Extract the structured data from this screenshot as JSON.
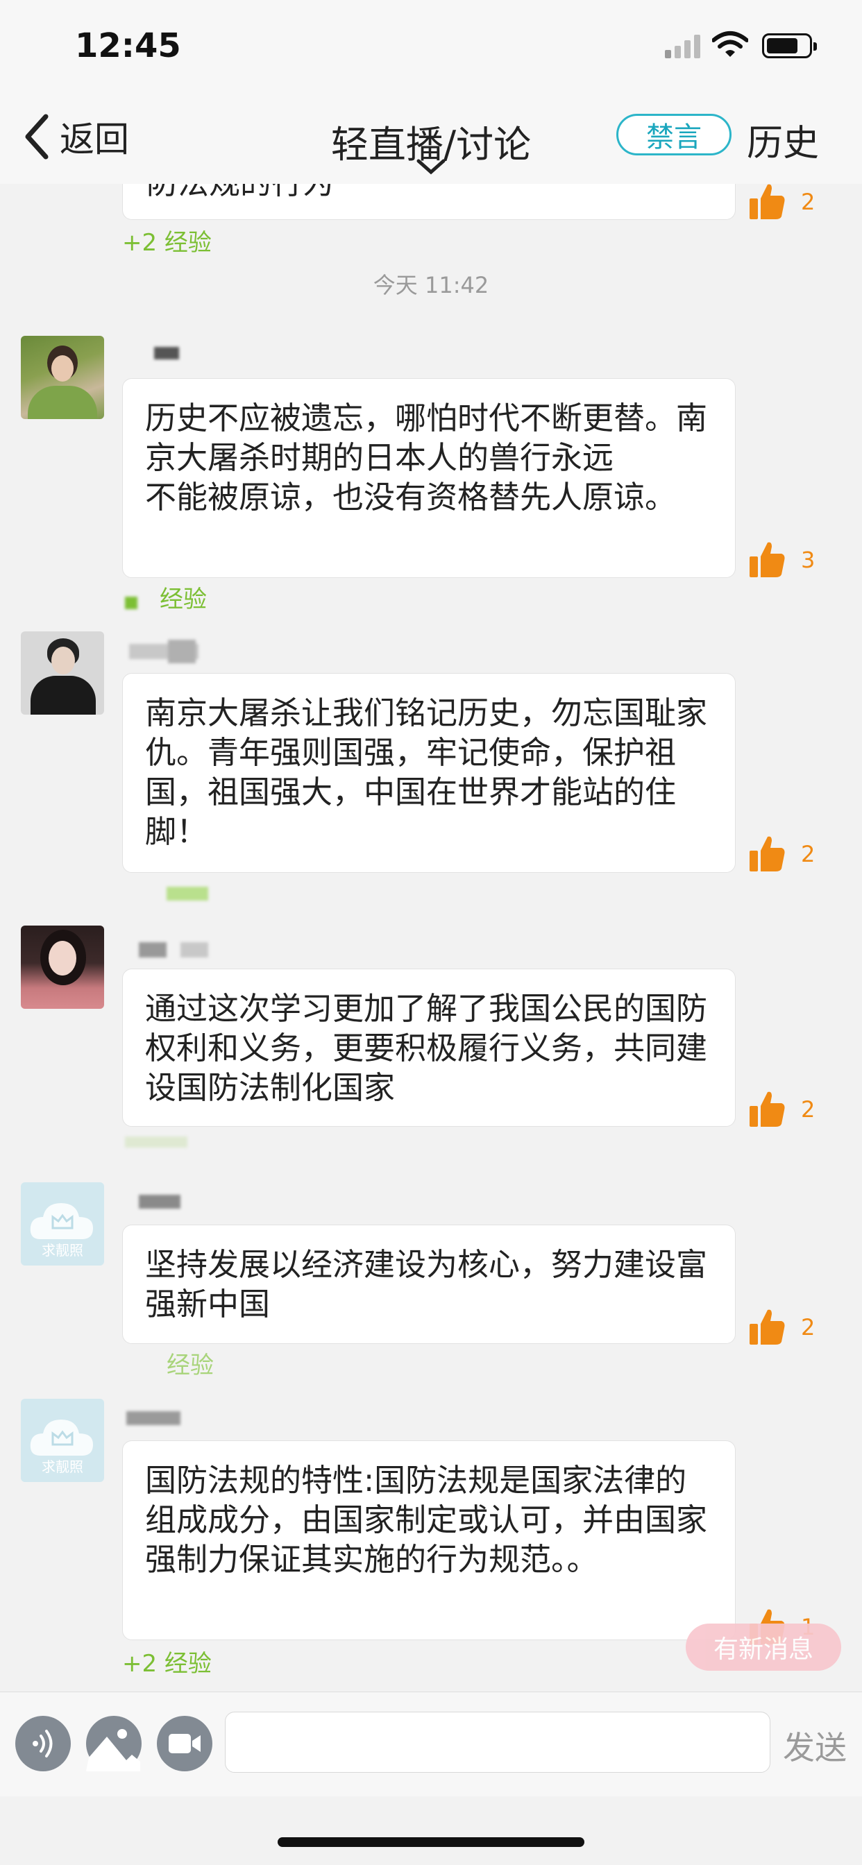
{
  "status_bar": {
    "time": "12:45"
  },
  "nav": {
    "back_label": "返回",
    "title": "轻直播/讨论",
    "mute_label": "禁言",
    "history_label": "历史"
  },
  "top_partial": {
    "text": "防法规的行为",
    "likes": "2",
    "exp": "+2 经验"
  },
  "timestamp": "今天 11:42",
  "messages": [
    {
      "text": "历史不应被遗忘，哪怕时代不断更替。南京大屠杀时期的日本人的兽行永远\n不能被原谅，也没有资格替先人原谅。",
      "likes": "3",
      "exp": "经验"
    },
    {
      "text": "南京大屠杀让我们铭记历史，勿忘国耻家仇。青年强则国强，牢记使命，保护祖国，祖国强大，中国在世界才能站的住脚！",
      "likes": "2"
    },
    {
      "text": "通过这次学习更加了解了我国公民的国防权利和义务，更要积极履行义务，共同建设国防法制化国家",
      "likes": "2"
    },
    {
      "text": "坚持发展以经济建设为核心，努力建设富强新中国",
      "likes": "2",
      "exp": "经验"
    },
    {
      "text": "国防法规的特性:国防法规是国家法律的组成成分，由国家制定或认可，并由国家强制力保证其实施的行为规范。。",
      "likes": "1",
      "exp": "+2 经验"
    }
  ],
  "avatar_placeholder_text": "求靓照",
  "new_message_label": "有新消息",
  "input": {
    "send_label": "发送",
    "value": ""
  },
  "colors": {
    "accent_teal": "#2cb5c9",
    "exp_green": "#7cbf34",
    "like_orange": "#f08a14",
    "new_msg_pink": "#f8c7ce"
  }
}
